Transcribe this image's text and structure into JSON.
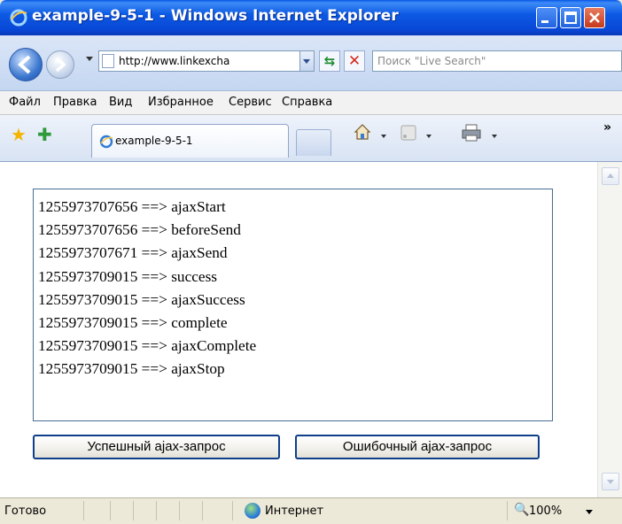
{
  "window": {
    "title": "example-9-5-1 - Windows Internet Explorer"
  },
  "address_bar": {
    "url": "http://www.linkexcha",
    "search_placeholder": "Поиск \"Live Search\""
  },
  "menu": {
    "items": [
      "Файл",
      "Правка",
      "Вид",
      "Избранное",
      "Сервис",
      "Справка"
    ]
  },
  "tab": {
    "label": "example-9-5-1"
  },
  "toolbar": {
    "overflow_label": "»"
  },
  "log": {
    "lines": [
      "1255973707656 ==> ajaxStart",
      "1255973707656 ==> beforeSend",
      "1255973707671 ==> ajaxSend",
      "1255973709015 ==> success",
      "1255973709015 ==> ajaxSuccess",
      "1255973709015 ==> complete",
      "1255973709015 ==> ajaxComplete",
      "1255973709015 ==> ajaxStop"
    ]
  },
  "buttons": {
    "success_label": "Успешный ajax-запрос",
    "error_label": "Ошибочный ajax-запрос"
  },
  "status": {
    "text": "Готово",
    "zone": "Интернет",
    "zoom": "100%"
  },
  "colors": {
    "titlebar": "#0d5ae4",
    "button_border": "#0f3f8a",
    "log_border": "#4a6d96"
  },
  "icons": [
    "ie-logo-icon",
    "minimize-icon",
    "maximize-icon",
    "close-icon",
    "back-icon",
    "forward-icon",
    "refresh-icon",
    "stop-icon",
    "favorites-star-icon",
    "add-favorites-icon",
    "page-icon",
    "home-icon",
    "feeds-icon",
    "print-icon",
    "globe-icon",
    "zoom-icon"
  ]
}
